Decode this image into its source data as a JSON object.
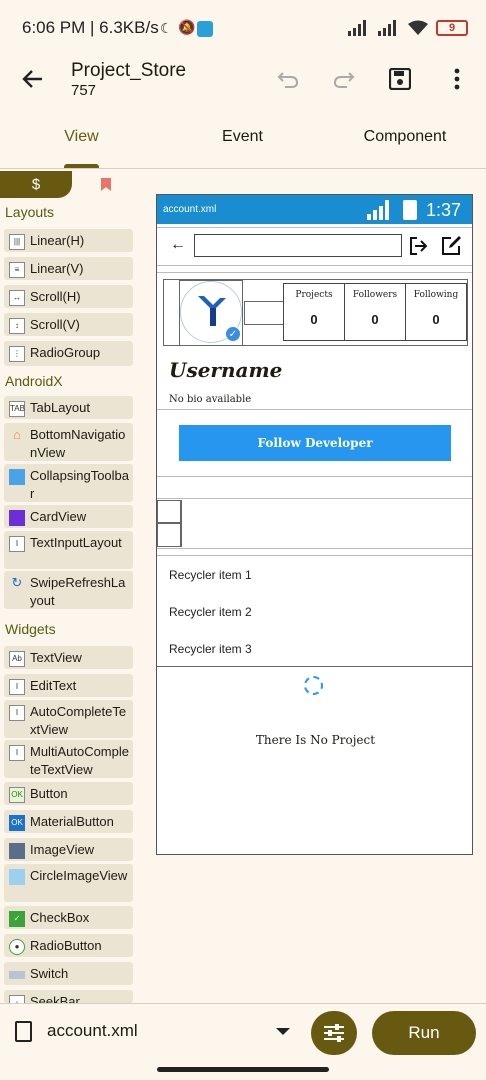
{
  "status_bar": {
    "time": "6:06 PM | 6.3KB/s",
    "battery": "9"
  },
  "toolbar": {
    "title": "Project_Store",
    "subtitle": "757"
  },
  "tabs": [
    {
      "label": "View"
    },
    {
      "label": "Event"
    },
    {
      "label": "Component"
    }
  ],
  "palette": {
    "header_icon": "$",
    "sections": {
      "layouts": "Layouts",
      "androidx": "AndroidX",
      "widgets": "Widgets"
    },
    "items": [
      {
        "label": "Linear(H)"
      },
      {
        "label": "Linear(V)"
      },
      {
        "label": "Scroll(H)"
      },
      {
        "label": "Scroll(V)"
      },
      {
        "label": "RadioGroup"
      },
      {
        "label": "TabLayout"
      },
      {
        "label": "BottomNavigationView"
      },
      {
        "label": "CollapsingToolbar"
      },
      {
        "label": "CardView"
      },
      {
        "label": "TextInputLayout"
      },
      {
        "label": "SwipeRefreshLayout"
      },
      {
        "label": "TextView"
      },
      {
        "label": "EditText"
      },
      {
        "label": "AutoCompleteTextView"
      },
      {
        "label": "MultiAutoCompleteTextView"
      },
      {
        "label": "Button"
      },
      {
        "label": "MaterialButton"
      },
      {
        "label": "ImageView"
      },
      {
        "label": "CircleImageView"
      },
      {
        "label": "CheckBox"
      },
      {
        "label": "RadioButton"
      },
      {
        "label": "Switch"
      },
      {
        "label": "SeekBar"
      }
    ]
  },
  "preview": {
    "file": "account.xml",
    "time": "1:37",
    "stats": [
      {
        "label": "Projects",
        "value": "0"
      },
      {
        "label": "Followers",
        "value": "0"
      },
      {
        "label": "Following",
        "value": "0"
      }
    ],
    "username": "Username",
    "bio": "No bio available",
    "follow_button": "Follow Developer",
    "recycler_items": [
      "Recycler item 1",
      "Recycler item 2",
      "Recycler item 3"
    ],
    "empty_text": "There Is No Project"
  },
  "bottom_bar": {
    "filename": "account.xml",
    "run_label": "Run"
  },
  "colors": {
    "accent": "#675a10",
    "preview_bar": "#1a8dd0",
    "follow_button": "#2696ef",
    "background": "#fdf6ec"
  }
}
